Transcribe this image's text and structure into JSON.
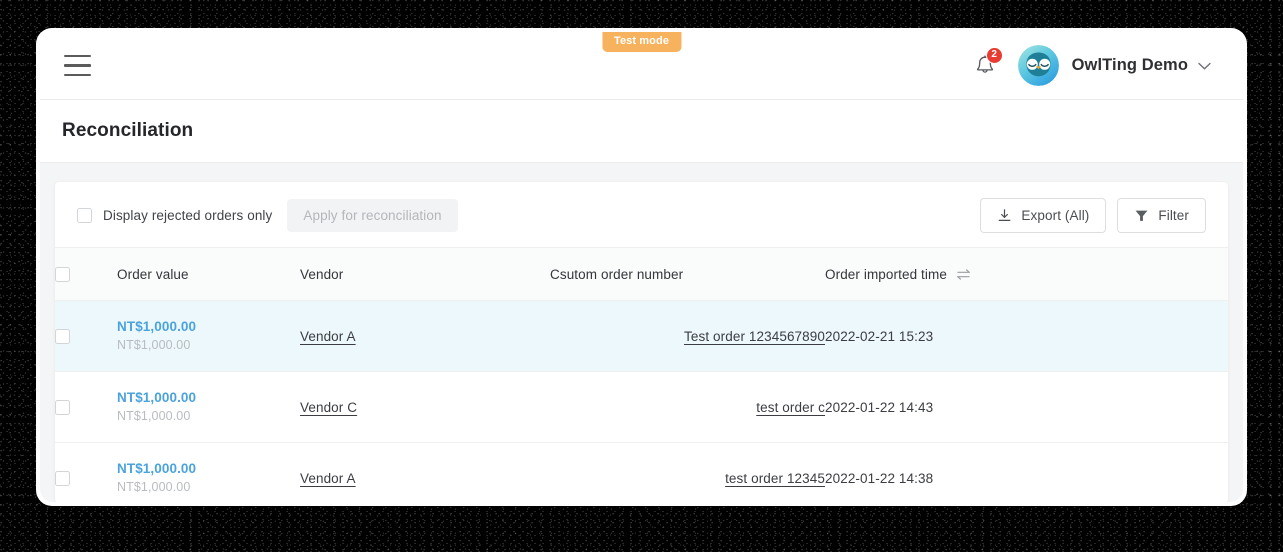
{
  "badge": {
    "test_mode": "Test mode"
  },
  "topbar": {
    "menu_icon": "hamburger-menu-icon",
    "bell_icon": "bell-icon",
    "notification_count": "2",
    "avatar_icon": "owl-avatar",
    "user_name": "OwlTing Demo",
    "caret_icon": "chevron-down-icon"
  },
  "page": {
    "title": "Reconciliation"
  },
  "toolbar": {
    "checkbox_label": "Display rejected orders only",
    "apply_label": "Apply for reconciliation",
    "export_label": "Export (All)",
    "export_icon": "download-icon",
    "filter_label": "Filter",
    "filter_icon": "funnel-icon"
  },
  "table": {
    "headers": {
      "select_all": "",
      "order_value": "Order value",
      "vendor": "Vendor",
      "custom_order_number": "Csutom order number",
      "order_imported_time": "Order imported time",
      "sort_icon": "sort-swap-icon"
    },
    "rows": [
      {
        "value_main": "NT$1,000.00",
        "value_sub": "NT$1,000.00",
        "vendor": "Vendor A",
        "order_number": "Test order 1234567890",
        "imported_time": "2022-02-21 15:23",
        "highlighted": true
      },
      {
        "value_main": "NT$1,000.00",
        "value_sub": "NT$1,000.00",
        "vendor": "Vendor C",
        "order_number": "test order c",
        "imported_time": "2022-01-22 14:43",
        "highlighted": false
      },
      {
        "value_main": "NT$1,000.00",
        "value_sub": "NT$1,000.00",
        "vendor": "Vendor A",
        "order_number": "test order 12345",
        "imported_time": "2022-01-22 14:38",
        "highlighted": false
      }
    ]
  },
  "colors": {
    "accent_blue": "#4ba3dd",
    "test_mode_orange": "#f7b25e",
    "badge_red": "#e83b32",
    "row_highlight": "#ecf8fc",
    "page_bg": "#f4f5f6"
  }
}
